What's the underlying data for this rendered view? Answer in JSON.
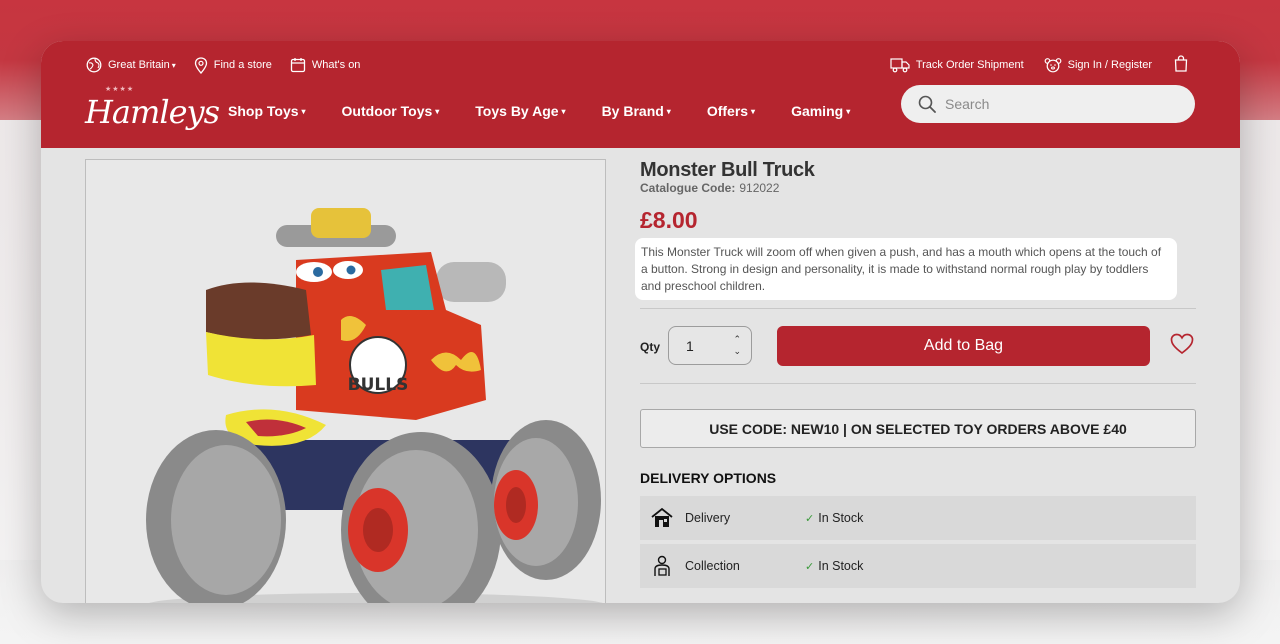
{
  "header": {
    "region": "Great Britain",
    "find_store": "Find a store",
    "whats_on": "What's on",
    "track_order": "Track Order Shipment",
    "sign_in": "Sign In / Register",
    "logo_text": "Hamleys",
    "logo_stars": "★★★★"
  },
  "nav": {
    "items": [
      "Shop Toys",
      "Outdoor Toys",
      "Toys By Age",
      "By Brand",
      "Offers",
      "Gaming"
    ]
  },
  "search": {
    "placeholder": "Search"
  },
  "product": {
    "title": "Monster Bull Truck",
    "catalogue_label": "Catalogue Code:",
    "catalogue_code": "912022",
    "price": "£8.00",
    "description": "This Monster Truck will zoom off when given a push, and has a mouth which opens at the touch of a button. Strong in design and personality, it is made to withstand normal rough play by toddlers and preschool children.",
    "image_text": "BULLS"
  },
  "purchase": {
    "qty_label": "Qty",
    "qty_value": "1",
    "add_button": "Add to Bag"
  },
  "promo": {
    "text": "USE CODE: NEW10 | ON SELECTED TOY ORDERS ABOVE £40"
  },
  "delivery": {
    "title": "DELIVERY OPTIONS",
    "options": [
      {
        "label": "Delivery",
        "status": "In Stock",
        "icon": "house-delivery-icon"
      },
      {
        "label": "Collection",
        "status": "In Stock",
        "icon": "person-collection-icon"
      }
    ]
  },
  "colors": {
    "brand_red": "#b5252f",
    "stock_green": "#3a9a3a"
  }
}
